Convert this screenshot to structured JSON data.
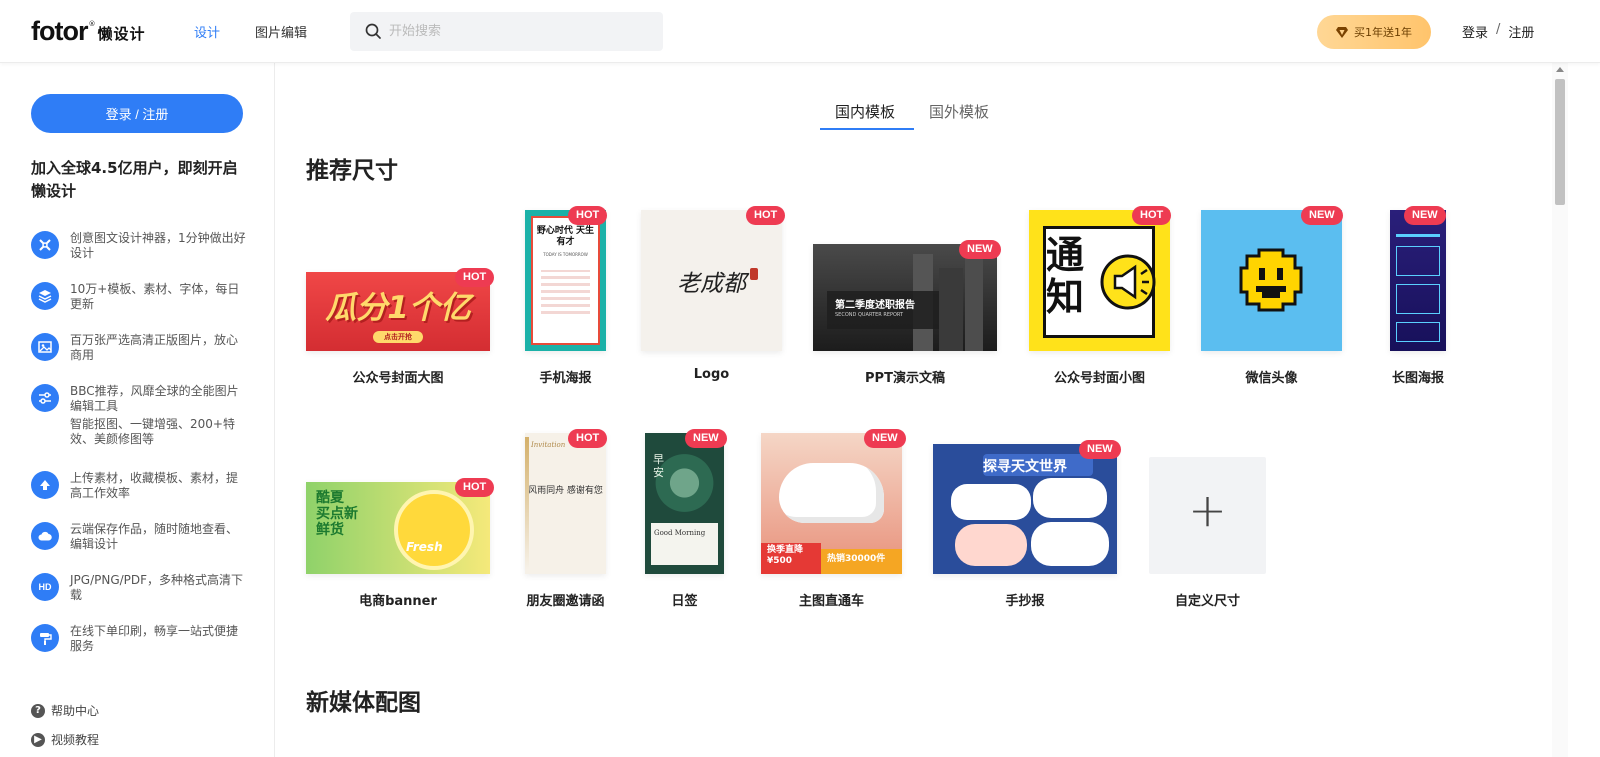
{
  "header": {
    "logo_text": "fotor",
    "logo_reg": "®",
    "logo_suffix": "懒设计",
    "nav": [
      "设计",
      "图片编辑"
    ],
    "search_placeholder": "开始搜索",
    "promo_label": "买1年送1年",
    "login": "登录",
    "separator": "/",
    "register": "注册"
  },
  "sidebar": {
    "login_button": "登录 / 注册",
    "title": "加入全球4.5亿用户，即刻开启懒设计",
    "features": [
      {
        "icon": "design-tool-icon",
        "text": "创意图文设计神器，1分钟做出好设计"
      },
      {
        "icon": "layers-icon",
        "text": "10万+模板、素材、字体，每日更新"
      },
      {
        "icon": "image-icon",
        "text": "百万张严选高清正版图片，放心商用"
      },
      {
        "icon": "sliders-icon",
        "text": "BBC推荐，风靡全球的全能图片编辑工具",
        "sub": "智能抠图、一键增强、200+特效、美颜修图等"
      },
      {
        "icon": "upload-icon",
        "text": "上传素材，收藏模板、素材，提高工作效率"
      },
      {
        "icon": "cloud-icon",
        "text": "云端保存作品，随时随地查看、编辑设计"
      },
      {
        "icon": "hd-icon",
        "text": "JPG/PNG/PDF，多种格式高清下载"
      },
      {
        "icon": "print-roller-icon",
        "text": "在线下单印刷，畅享一站式便捷服务"
      }
    ],
    "help": "帮助中心",
    "video": "视频教程"
  },
  "main": {
    "tabs": [
      "国内模板",
      "国外模板"
    ],
    "section1": "推荐尺寸",
    "section2": "新媒体配图",
    "row1": [
      {
        "label": "公众号封面大图",
        "badge": "HOT",
        "thumb_text": "瓜分1个亿",
        "thumb_sub": "点击开抢"
      },
      {
        "label": "手机海报",
        "badge": "HOT",
        "thumb_text": "野心时代 天生有才",
        "thumb_sub": "TODAY IS TOMORROW"
      },
      {
        "label": "Logo",
        "badge": "HOT",
        "thumb_text": "老成都"
      },
      {
        "label": "PPT演示文稿",
        "badge": "NEW",
        "thumb_text": "第二季度述职报告",
        "thumb_sub": "SECOND QUARTER REPORT"
      },
      {
        "label": "公众号封面小图",
        "badge": "HOT",
        "thumb_text": "通知"
      },
      {
        "label": "微信头像",
        "badge": "NEW"
      },
      {
        "label": "长图海报",
        "badge": "NEW"
      }
    ],
    "row2": [
      {
        "label": "电商banner",
        "badge": "HOT",
        "thumb_text": "酷夏 买点新鲜货",
        "thumb_sub": "Fresh"
      },
      {
        "label": "朋友圈邀请函",
        "badge": "HOT",
        "thumb_text": "风雨同舟 感谢有您",
        "thumb_sub": "Invitation"
      },
      {
        "label": "日签",
        "badge": "NEW",
        "thumb_text": "早安",
        "thumb_sub": "Good Morning"
      },
      {
        "label": "主图直通车",
        "badge": "NEW",
        "thumb_text": "换季直降 ¥500",
        "thumb_sub": "热销30000件"
      },
      {
        "label": "手抄报",
        "badge": "NEW",
        "thumb_text": "探寻天文世界"
      },
      {
        "label": "自定义尺寸",
        "thumb_text": "+"
      }
    ]
  }
}
